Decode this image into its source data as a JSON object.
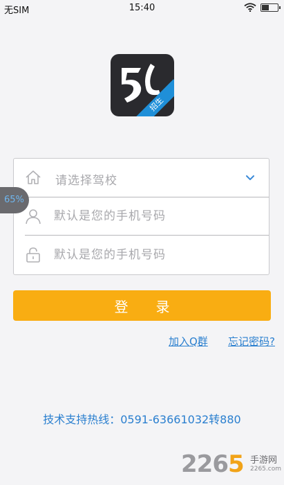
{
  "status_bar": {
    "carrier": "无SIM",
    "time": "15:40",
    "battery_level": 0.45
  },
  "logo": {
    "ribbon_text": "招生"
  },
  "form": {
    "school_select": {
      "placeholder": "请选择驾校",
      "icon": "home-icon"
    },
    "phone_input": {
      "placeholder": "默认是您的手机号码",
      "icon": "user-icon"
    },
    "password_input": {
      "placeholder": "默认是您的手机号码",
      "icon": "lock-icon"
    }
  },
  "float_bubble": {
    "text": "65%"
  },
  "login_button": {
    "label": "登录"
  },
  "links": {
    "join_group": "加入Q群",
    "forgot_password": "忘记密码?"
  },
  "hotline": "技术支持热线：0591-63661032转880",
  "watermark": {
    "number_main": "226",
    "number_accent": "5",
    "cn": "手游网",
    "url": "2265.com"
  },
  "colors": {
    "accent": "#f9ad12",
    "link": "#2a7fcf",
    "logo_bg": "#2a2a2e",
    "ribbon": "#1f8fd8"
  }
}
